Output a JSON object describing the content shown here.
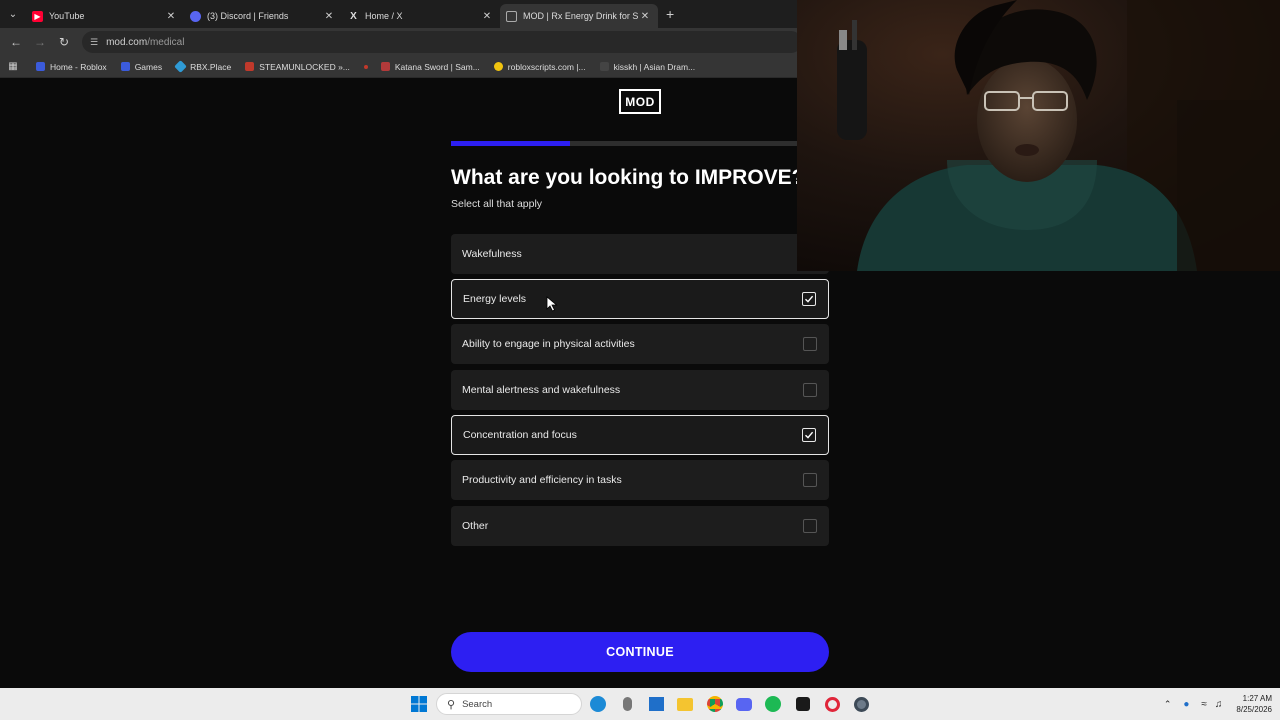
{
  "browser": {
    "tabs": [
      {
        "title": "YouTube",
        "color": "#ff0033",
        "active": false
      },
      {
        "title": "(3) Discord | Friends",
        "color": "#5865f2",
        "active": false
      },
      {
        "title": "Home / X",
        "color": "#000000",
        "active": false
      },
      {
        "title": "MOD | Rx Energy Drink for Sust",
        "color": "#444444",
        "active": true
      }
    ],
    "url_domain": "mod.com",
    "url_path": "/medical",
    "bookmarks": [
      {
        "label": "Home - Roblox",
        "color": "#3b5bdb"
      },
      {
        "label": "Games",
        "color": "#3b5bdb"
      },
      {
        "label": "RBX.Place",
        "color": "#2f9bd6"
      },
      {
        "label": "STEAMUNLOCKED »...",
        "color": "#c0392b"
      },
      {
        "label": "",
        "color": "#c0392b"
      },
      {
        "label": "Katana Sword | Sam...",
        "color": "#b23a3a"
      },
      {
        "label": "robloxscripts.com |...",
        "color": "#f1c40f"
      },
      {
        "label": "kisskh | Asian Dram...",
        "color": "#444444"
      }
    ]
  },
  "page": {
    "logo": "MOD",
    "progress_fraction": 0.315,
    "title": "What are you looking to IMPROVE?",
    "subtitle": "Select all that apply",
    "options": [
      {
        "label": "Wakefulness",
        "checked": false
      },
      {
        "label": "Energy levels",
        "checked": true
      },
      {
        "label": "Ability to engage in physical activities",
        "checked": false
      },
      {
        "label": "Mental alertness and wakefulness",
        "checked": false
      },
      {
        "label": "Concentration and focus",
        "checked": true
      },
      {
        "label": "Productivity and efficiency in tasks",
        "checked": false
      },
      {
        "label": "Other",
        "checked": false
      }
    ],
    "continue_label": "CONTINUE",
    "accent_color": "#2d1ff2"
  },
  "taskbar": {
    "search_placeholder": "Search",
    "time": "1:27 AM",
    "date": "8/25/2026"
  }
}
